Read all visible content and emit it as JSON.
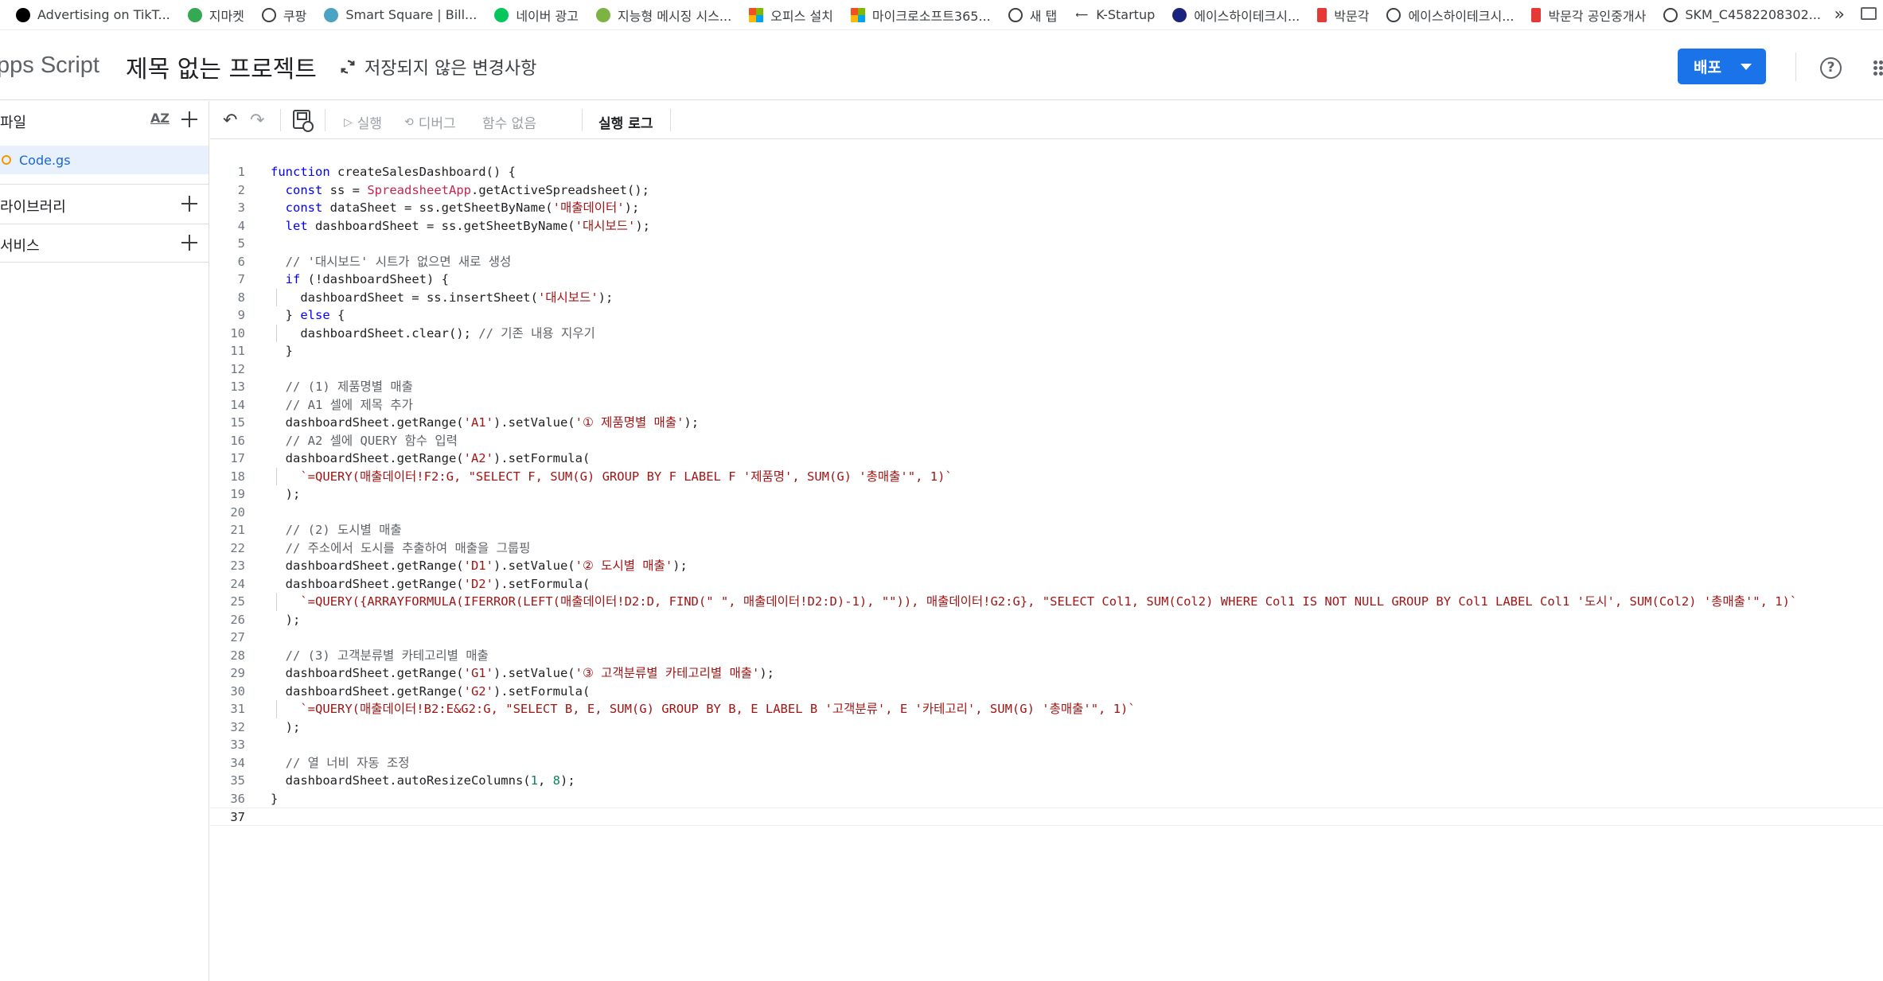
{
  "bookmarks": [
    {
      "label": "Advertising on TikT...",
      "icon": "tiktok-icon",
      "color": "#000000"
    },
    {
      "label": "지마켓",
      "icon": "gmarket-icon",
      "color": "#34a853"
    },
    {
      "label": "쿠팡",
      "icon": "globe-icon",
      "color": "#3c4043"
    },
    {
      "label": "Smart Square | Bill...",
      "icon": "heart-icon",
      "color": "#4ba3c3"
    },
    {
      "label": "네이버 광고",
      "icon": "naver-icon",
      "color": "#03c75a"
    },
    {
      "label": "지능형 메시징 시스...",
      "icon": "leaf-icon",
      "color": "#7cb342"
    },
    {
      "label": "오피스 설치",
      "icon": "microsoft-icon",
      "color": "#f25022"
    },
    {
      "label": "마이크로소프트365...",
      "icon": "microsoft-icon",
      "color": "#f25022"
    },
    {
      "label": "새 탭",
      "icon": "globe-icon",
      "color": "#3c4043"
    },
    {
      "label": "K-Startup",
      "icon": "arrow-icon",
      "color": "#3c4043"
    },
    {
      "label": "에이스하이테크시...",
      "icon": "p-icon",
      "color": "#1a237e"
    },
    {
      "label": "박문각",
      "icon": "bookmark-red-icon",
      "color": "#e53935"
    },
    {
      "label": "에이스하이테크시...",
      "icon": "globe-icon",
      "color": "#3c4043"
    },
    {
      "label": "박문각 공인중개사",
      "icon": "bookmark-red-icon",
      "color": "#e53935"
    },
    {
      "label": "SKM_C4582208302...",
      "icon": "globe-icon",
      "color": "#3c4043"
    }
  ],
  "bookmarks_more": "»",
  "header": {
    "app_title": "pps Script",
    "project_title": "제목 없는 프로젝트",
    "unsaved_text": "저장되지 않은 변경사항",
    "deploy_label": "배포",
    "help_label": "?",
    "accent_color": "#1a73e8"
  },
  "sidebar": {
    "files_label": "파일",
    "sort_label": "AZ",
    "file_name": "Code.gs",
    "libraries_label": "라이브러리",
    "services_label": "서비스"
  },
  "toolbar": {
    "run_label": "실행",
    "debug_label": "디버그",
    "function_label": "함수 없음",
    "log_label": "실행 로그"
  },
  "code_lines": [
    "function createSalesDashboard() {",
    "  const ss = SpreadsheetApp.getActiveSpreadsheet();",
    "  const dataSheet = ss.getSheetByName('매출데이터');",
    "  let dashboardSheet = ss.getSheetByName('대시보드');",
    "",
    "  // '대시보드' 시트가 없으면 새로 생성",
    "  if (!dashboardSheet) {",
    "    dashboardSheet = ss.insertSheet('대시보드');",
    "  } else {",
    "    dashboardSheet.clear(); // 기존 내용 지우기",
    "  }",
    "",
    "  // (1) 제품명별 매출",
    "  // A1 셀에 제목 추가",
    "  dashboardSheet.getRange('A1').setValue('① 제품명별 매출');",
    "  // A2 셀에 QUERY 함수 입력",
    "  dashboardSheet.getRange('A2').setFormula(",
    "    `=QUERY(매출데이터!F2:G, \"SELECT F, SUM(G) GROUP BY F LABEL F '제품명', SUM(G) '총매출'\", 1)`",
    "  );",
    "",
    "  // (2) 도시별 매출",
    "  // 주소에서 도시를 추출하여 매출을 그룹핑",
    "  dashboardSheet.getRange('D1').setValue('② 도시별 매출');",
    "  dashboardSheet.getRange('D2').setFormula(",
    "    `=QUERY({ARRAYFORMULA(IFERROR(LEFT(매출데이터!D2:D, FIND(\" \", 매출데이터!D2:D)-1), \"\")), 매출데이터!G2:G}, \"SELECT Col1, SUM(Col2) WHERE Col1 IS NOT NULL GROUP BY Col1 LABEL Col1 '도시', SUM(Col2) '총매출'\", 1)`",
    "  );",
    "",
    "  // (3) 고객분류별 카테고리별 매출",
    "  dashboardSheet.getRange('G1').setValue('③ 고객분류별 카테고리별 매출');",
    "  dashboardSheet.getRange('G2').setFormula(",
    "    `=QUERY(매출데이터!B2:E&G2:G, \"SELECT B, E, SUM(G) GROUP BY B, E LABEL B '고객분류', E '카테고리', SUM(G) '총매출'\", 1)`",
    "  );",
    "",
    "  // 열 너비 자동 조정",
    "  dashboardSheet.autoResizeColumns(1, 8);",
    "}",
    ""
  ]
}
